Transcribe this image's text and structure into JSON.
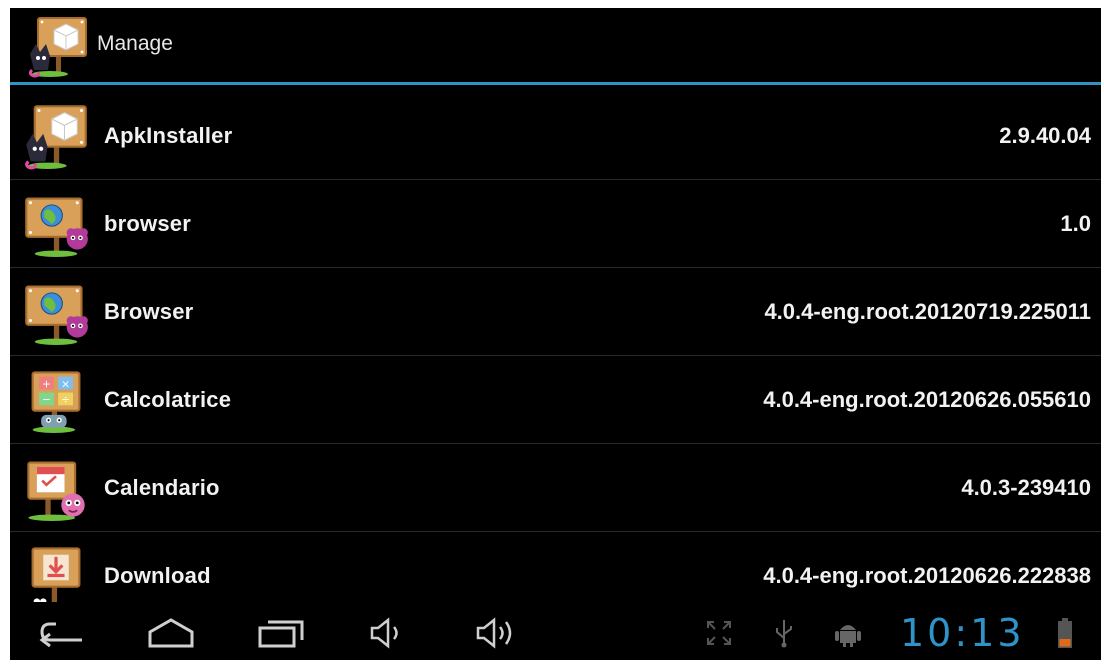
{
  "action_bar": {
    "title": "Manage",
    "icon": "apkinstaller-signpost-icon"
  },
  "apps": [
    {
      "name": "ApkInstaller",
      "version": "2.9.40.04",
      "icon": "apkinstaller-signpost-icon"
    },
    {
      "name": "browser",
      "version": "1.0",
      "icon": "globe-signpost-icon"
    },
    {
      "name": "Browser",
      "version": "4.0.4-eng.root.20120719.225011",
      "icon": "globe-signpost-icon"
    },
    {
      "name": "Calcolatrice",
      "version": "4.0.4-eng.root.20120626.055610",
      "icon": "calculator-signpost-icon"
    },
    {
      "name": "Calendario",
      "version": "4.0.3-239410",
      "icon": "calendar-signpost-icon"
    },
    {
      "name": "Download",
      "version": "4.0.4-eng.root.20120626.222838",
      "icon": "download-signpost-icon"
    }
  ],
  "system_bar": {
    "nav_icons": [
      "back-icon",
      "home-icon",
      "recent-apps-icon",
      "volume-down-icon",
      "volume-up-icon"
    ],
    "status_icons": [
      "fullscreen-icon",
      "usb-icon",
      "android-debug-icon",
      "battery-icon"
    ],
    "clock": "10:13"
  },
  "colors": {
    "accent": "#2f93c8",
    "background": "#000000",
    "text": "#f2f2f2",
    "signpost_wood": "#d9a05a",
    "battery_low": "#e06a1a"
  }
}
